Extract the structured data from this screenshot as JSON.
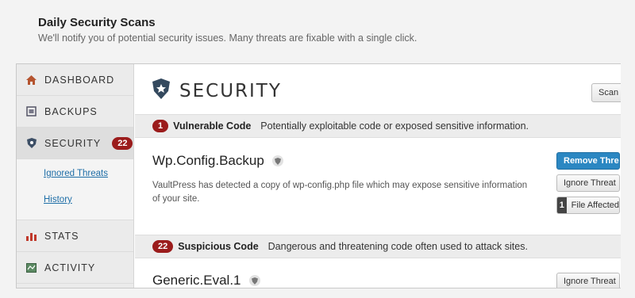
{
  "intro": {
    "title": "Daily Security Scans",
    "subtitle": "We'll notify you of potential security issues. Many threats are fixable with a single click."
  },
  "sidebar": {
    "items": [
      {
        "label": "Dashboard",
        "icon": "home-icon"
      },
      {
        "label": "Backups",
        "icon": "backups-icon"
      },
      {
        "label": "Security",
        "icon": "shield-icon",
        "badge": "22"
      },
      {
        "label": "Stats",
        "icon": "bar-chart-icon"
      },
      {
        "label": "Activity",
        "icon": "activity-icon"
      }
    ],
    "sub_links": [
      "Ignored Threats",
      "History"
    ]
  },
  "main": {
    "title": "SECURITY",
    "scan_button": "Scan",
    "categories": [
      {
        "count": "1",
        "name": "Vulnerable Code",
        "description": "Potentially exploitable code or exposed sensitive information."
      },
      {
        "count": "22",
        "name": "Suspicious Code",
        "description": "Dangerous and threatening code often used to attack sites."
      }
    ],
    "threats": [
      {
        "name": "Wp.Config.Backup",
        "description": "VaultPress has detected a copy of wp-config.php file which may expose sensitive information of your site.",
        "remove_label": "Remove Threat",
        "ignore_label": "Ignore Threat",
        "files_count": "1",
        "files_label": "File Affected"
      },
      {
        "name": "Generic.Eval.1",
        "ignore_label": "Ignore Threat"
      }
    ]
  },
  "colors": {
    "badge": "#9b1c1c",
    "primary_button": "#2b87c2",
    "link": "#1e6ea7"
  }
}
